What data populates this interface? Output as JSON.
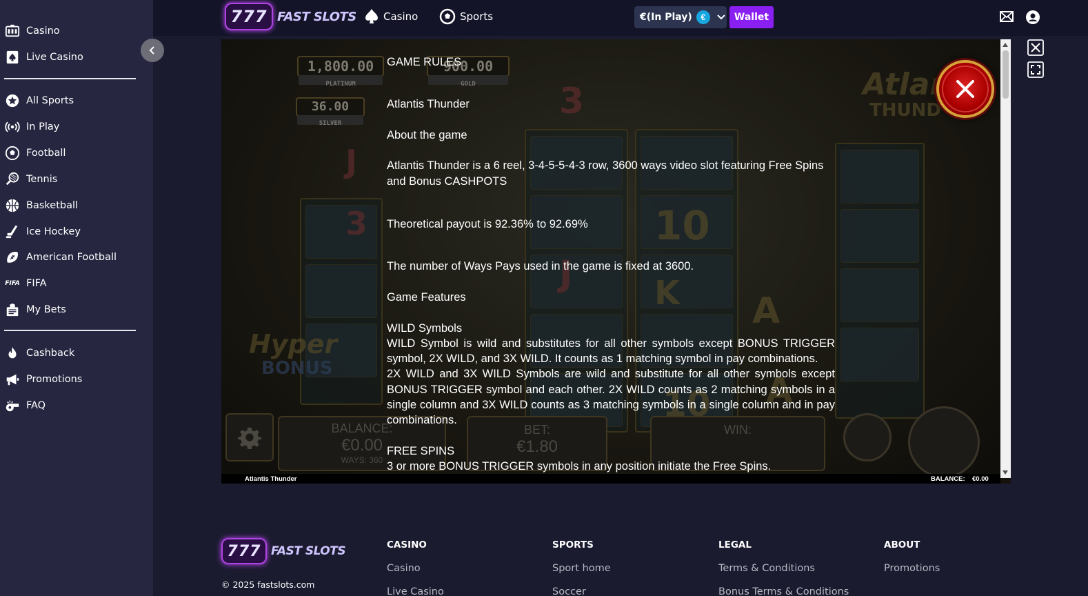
{
  "sidebar": {
    "items": [
      {
        "label": "Casino",
        "icon": "casino-icon"
      },
      {
        "label": "Live Casino",
        "icon": "card-spade-icon"
      },
      {
        "label": "All Sports",
        "icon": "star-badge-icon"
      },
      {
        "label": "In Play",
        "icon": "broadcast-icon"
      },
      {
        "label": "Football",
        "icon": "soccer-ball-icon"
      },
      {
        "label": "Tennis",
        "icon": "tennis-racket-icon"
      },
      {
        "label": "Basketball",
        "icon": "basketball-icon"
      },
      {
        "label": "Ice Hockey",
        "icon": "hockey-stick-icon"
      },
      {
        "label": "American Football",
        "icon": "american-football-icon"
      },
      {
        "label": "FIFA",
        "icon": "fifa-logo-icon"
      },
      {
        "label": "My Bets",
        "icon": "bet-slip-icon"
      },
      {
        "label": "Cashback",
        "icon": "flame-icon"
      },
      {
        "label": "Promotions",
        "icon": "megaphone-icon"
      },
      {
        "label": "FAQ",
        "icon": "whistle-icon"
      }
    ]
  },
  "header": {
    "logo_sevens": "777",
    "logo_word": "FAST SLOTS",
    "nav": [
      {
        "label": "Casino",
        "icon": "spade-icon"
      },
      {
        "label": "Sports",
        "icon": "soccer-ball-icon"
      }
    ],
    "balance": "€(In Play)",
    "currency_symbol": "€",
    "wallet_label": "Wallet"
  },
  "game": {
    "title_footer": "Atlantis Thunder",
    "balance_label": "BALANCE:",
    "balance_value": "€0.00",
    "background": {
      "jackpots": [
        {
          "value": "1,800.00",
          "label": "PLATINUM"
        },
        {
          "value": "900.00",
          "label": "GOLD"
        },
        {
          "value": "36.00",
          "label": "SILVER"
        }
      ],
      "logo_text_1": "Atlan",
      "logo_text_2": "THUND",
      "hyper_text": "Hyper",
      "bonus_text": "BONUS",
      "balance_panel_label": "BALANCE:",
      "balance_panel_value": "€0.00",
      "ways_label": "WAYS: 360",
      "bet_label": "BET:",
      "bet_value": "€1.80",
      "win_label": "WIN:",
      "reel_symbols": [
        "J",
        "3",
        "J",
        "10",
        "A",
        "K",
        "A",
        "10"
      ]
    },
    "rules": {
      "heading": "GAME RULES",
      "game_name": "Atlantis Thunder",
      "about_heading": "About the game",
      "about_text": "Atlantis Thunder is a 6 reel, 3-4-5-5-4-3 row, 3600 ways video slot featuring Free Spins and Bonus CASHPOTS",
      "payout_text": "Theoretical payout is 92.36% to 92.69%",
      "ways_text": "The number of Ways Pays used in the game is fixed at 3600.",
      "features_heading": "Game Features",
      "wild_heading": "WILD Symbols",
      "wild_text_1": "WILD Symbol is wild and substitutes for all other symbols except BONUS TRIGGER symbol, 2X WILD, and 3X WILD. It counts as 1 matching symbol in pay combinations.",
      "wild_text_2": "2X WILD and 3X WILD Symbols are wild and substitute for all other symbols except BONUS TRIGGER symbol and each other. 2X WILD counts as 2 matching symbols in a single column and 3X WILD counts as 3 matching symbols in a single column and in pay combinations.",
      "free_spins_heading": "FREE SPINS",
      "free_spins_text": "3 or more BONUS TRIGGER symbols in any position initiate the Free Spins."
    }
  },
  "footer": {
    "copyright": "© 2025 fastslots.com",
    "columns": [
      {
        "heading": "CASINO",
        "links": [
          "Casino",
          "Live Casino"
        ]
      },
      {
        "heading": "SPORTS",
        "links": [
          "Sport home",
          "Soccer"
        ]
      },
      {
        "heading": "LEGAL",
        "links": [
          "Terms & Conditions",
          "Bonus Terms & Conditions"
        ]
      },
      {
        "heading": "ABOUT",
        "links": [
          "Promotions"
        ]
      }
    ]
  },
  "colors": {
    "sidebar_bg": "#262641",
    "page_bg": "#1b1b30",
    "header_bg": "#141429",
    "wallet_accent": "#8a1ff1",
    "close_red": "#c80000",
    "euro_badge": "#16a6e0"
  }
}
